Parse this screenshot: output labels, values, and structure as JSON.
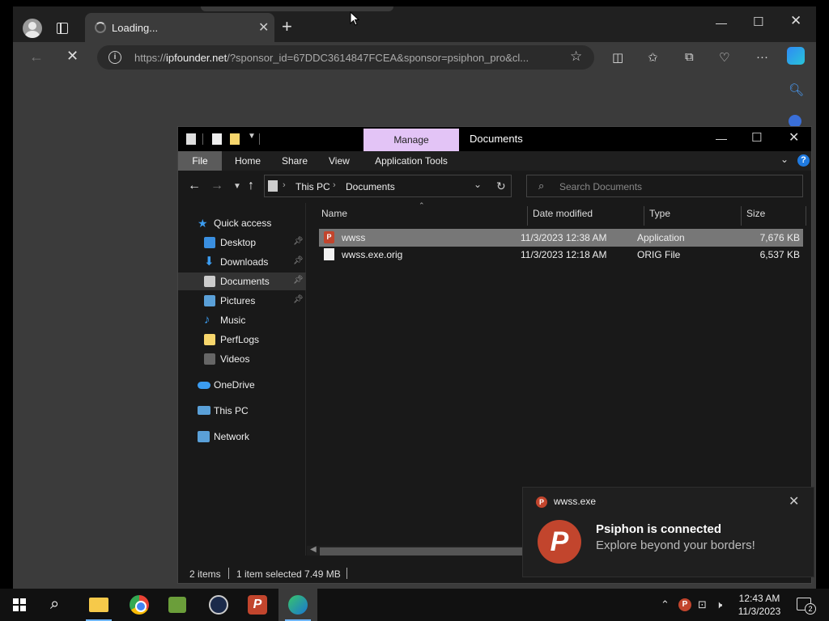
{
  "browser": {
    "tab_title": "Loading...",
    "url_domain": "ipfounder.net",
    "url_prefix": "https://",
    "url_rest": "/?sponsor_id=67DDC3614847FCEA&sponsor=psiphon_pro&cl..."
  },
  "explorer": {
    "title": "Documents",
    "ribbon": {
      "manage": "Manage",
      "file": "File",
      "home": "Home",
      "share": "Share",
      "view": "View",
      "app_tools": "Application Tools"
    },
    "breadcrumb": [
      "This PC",
      "Documents"
    ],
    "search_placeholder": "Search Documents",
    "nav": {
      "quick_access": "Quick access",
      "desktop": "Desktop",
      "downloads": "Downloads",
      "documents": "Documents",
      "pictures": "Pictures",
      "music": "Music",
      "perflogs": "PerfLogs",
      "videos": "Videos",
      "onedrive": "OneDrive",
      "this_pc": "This PC",
      "network": "Network"
    },
    "columns": {
      "name": "Name",
      "date": "Date modified",
      "type": "Type",
      "size": "Size"
    },
    "files": [
      {
        "name": "wwss",
        "date": "11/3/2023 12:38 AM",
        "type": "Application",
        "size": "7,676 KB",
        "selected": true
      },
      {
        "name": "wwss.exe.orig",
        "date": "11/3/2023 12:18 AM",
        "type": "ORIG File",
        "size": "6,537 KB",
        "selected": false
      }
    ],
    "status": {
      "items": "2 items",
      "selected": "1 item selected  7.49 MB"
    }
  },
  "toast": {
    "app_name": "wwss.exe",
    "title": "Psiphon is connected",
    "message": "Explore beyond your borders!",
    "logo_letter": "P"
  },
  "taskbar": {
    "time": "12:43 AM",
    "date": "11/3/2023",
    "notification_count": "2"
  }
}
